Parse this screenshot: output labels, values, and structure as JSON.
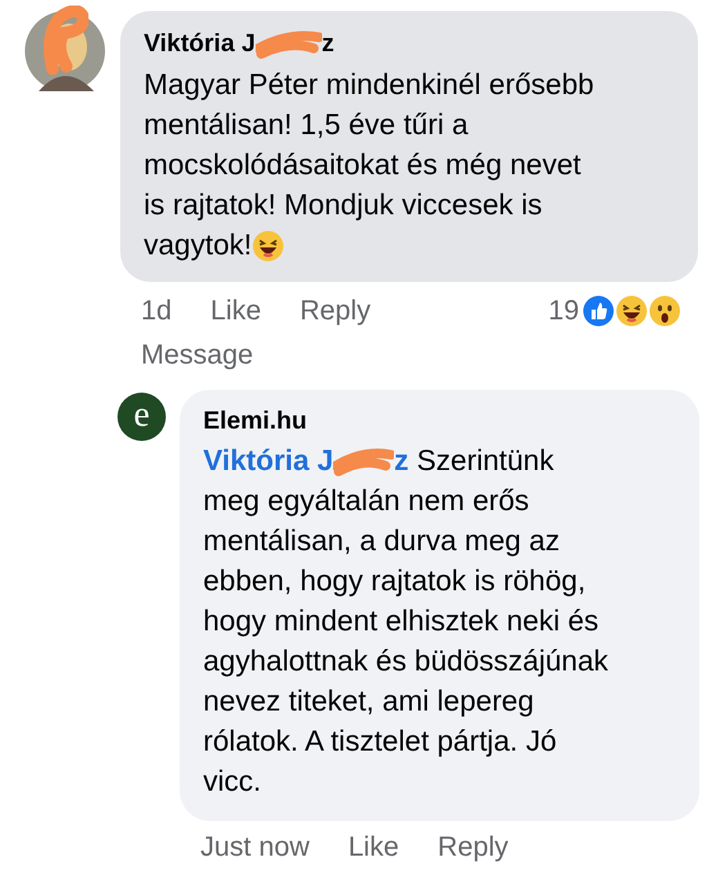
{
  "comment": {
    "author_start": "Viktória J",
    "author_end": "z",
    "text": "Magyar Péter mindenkinél erősebb mentálisan! 1,5 éve tűri a mocskolódásaitokat és még nevet is rajtatok! Mondjuk viccesek is vagytok!",
    "time": "1d",
    "actions": [
      "Like",
      "Reply",
      "Message"
    ],
    "reaction_count": "19"
  },
  "reply": {
    "logo_letter": "e",
    "author": "Elemi.hu",
    "mention_start": "Viktória J",
    "mention_end": "z",
    "text": "Szerintünk meg egyáltalán nem erős mentálisan, a durva meg az ebben, hogy rajtatok is röhög, hogy mindent elhisztek neki és agyhalottnak és büdösszájúnak nevez titeket, ami lepereg rólatok. A tisztelet pártja. Jó vicc.",
    "time": "Just now",
    "actions": [
      "Like",
      "Reply"
    ]
  }
}
